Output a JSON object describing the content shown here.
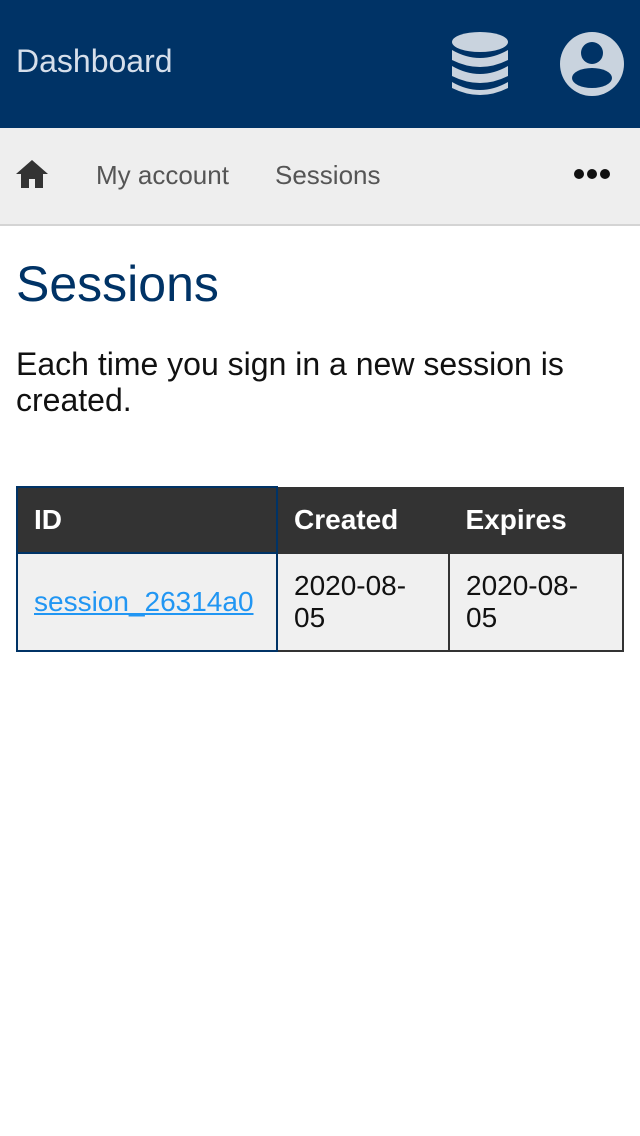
{
  "header": {
    "title": "Dashboard",
    "database_icon": "database-icon",
    "user_icon": "user-circle-icon",
    "background_color": "#003366"
  },
  "nav": {
    "home_icon": "home-icon",
    "items": [
      {
        "label": "My account"
      },
      {
        "label": "Sessions"
      }
    ],
    "more_icon": "more-horizontal-icon"
  },
  "main": {
    "title": "Sessions",
    "description": "Each time you sign in a new session is created.",
    "table": {
      "columns": [
        "ID",
        "Created",
        "Expires"
      ],
      "rows": [
        {
          "id": "session_26314a0",
          "created": "2020-08-05",
          "expires": "2020-08-05"
        }
      ]
    }
  },
  "colors": {
    "primary": "#003366",
    "link": "#2196f3",
    "table_header": "#333333"
  }
}
